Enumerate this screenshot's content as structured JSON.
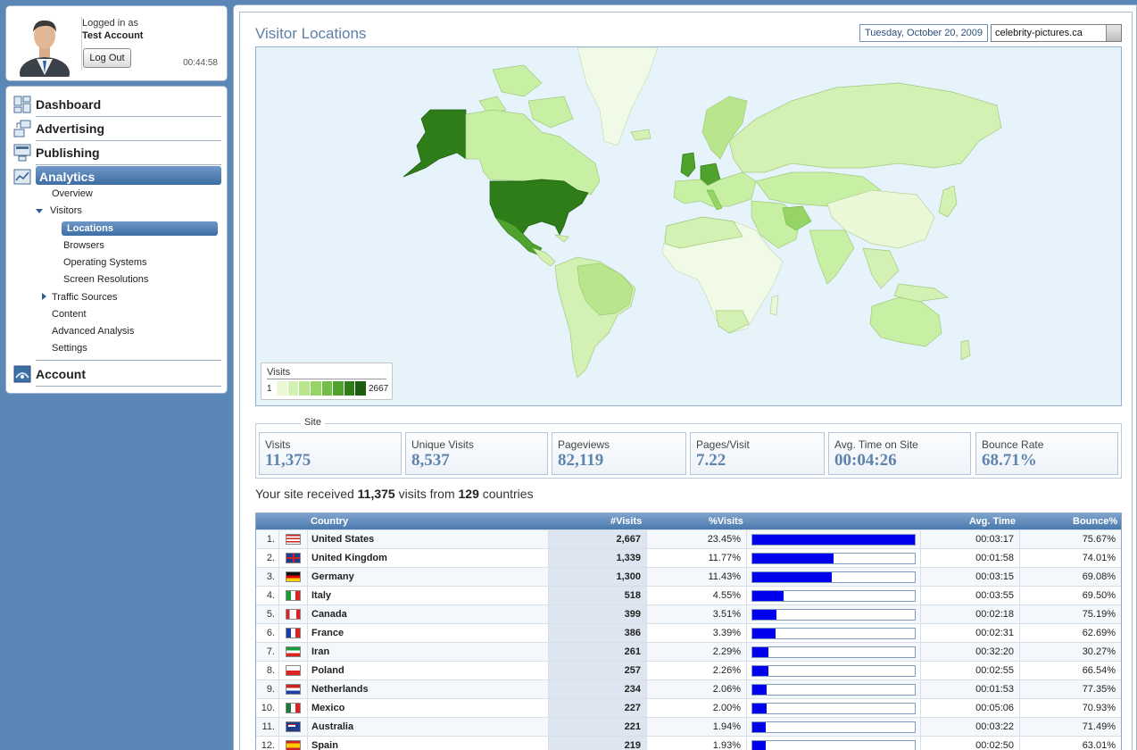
{
  "user": {
    "logged_in_label": "Logged in as",
    "account_name": "Test Account",
    "logout_label": "Log Out",
    "session_time": "00:44:58"
  },
  "nav": {
    "dashboard": "Dashboard",
    "advertising": "Advertising",
    "publishing": "Publishing",
    "analytics": "Analytics",
    "overview": "Overview",
    "visitors": "Visitors",
    "locations": "Locations",
    "browsers": "Browsers",
    "operating_systems": "Operating Systems",
    "screen_resolutions": "Screen Resolutions",
    "traffic_sources": "Traffic Sources",
    "content": "Content",
    "advanced_analysis": "Advanced Analysis",
    "settings": "Settings",
    "account": "Account"
  },
  "page": {
    "title": "Visitor Locations",
    "date": "Tuesday, October 20, 2009",
    "site": "celebrity-pictures.ca"
  },
  "map_legend": {
    "title": "Visits",
    "min": "1",
    "max": "2667",
    "scale_colors": [
      "#eaf8d8",
      "#d4f1b4",
      "#b9e68d",
      "#97d467",
      "#72bf45",
      "#4fa22c",
      "#2e7d19",
      "#1e5c10"
    ]
  },
  "site_metrics": {
    "legend": "Site",
    "items": [
      {
        "label": "Visits",
        "value": "11,375"
      },
      {
        "label": "Unique Visits",
        "value": "8,537"
      },
      {
        "label": "Pageviews",
        "value": "82,119"
      },
      {
        "label": "Pages/Visit",
        "value": "7.22"
      },
      {
        "label": "Avg. Time on Site",
        "value": "00:04:26"
      },
      {
        "label": "Bounce Rate",
        "value": "68.71%"
      }
    ]
  },
  "summary": {
    "prefix": "Your site received ",
    "visits": "11,375",
    "middle": " visits from ",
    "countries": "129",
    "suffix": " countries"
  },
  "table": {
    "headers": {
      "country": "Country",
      "visits": "#Visits",
      "pct": "%Visits",
      "avg_time": "Avg. Time",
      "bounce": "Bounce%"
    },
    "rows": [
      {
        "rank": "1.",
        "country": "United States",
        "visits": "2,667",
        "pct": "23.45%",
        "share": 1.0,
        "time": "00:03:17",
        "bounce": "75.67%",
        "flag": "us"
      },
      {
        "rank": "2.",
        "country": "United Kingdom",
        "visits": "1,339",
        "pct": "11.77%",
        "share": 0.502,
        "time": "00:01:58",
        "bounce": "74.01%",
        "flag": "gb"
      },
      {
        "rank": "3.",
        "country": "Germany",
        "visits": "1,300",
        "pct": "11.43%",
        "share": 0.487,
        "time": "00:03:15",
        "bounce": "69.08%",
        "flag": "de"
      },
      {
        "rank": "4.",
        "country": "Italy",
        "visits": "518",
        "pct": "4.55%",
        "share": 0.194,
        "time": "00:03:55",
        "bounce": "69.50%",
        "flag": "it"
      },
      {
        "rank": "5.",
        "country": "Canada",
        "visits": "399",
        "pct": "3.51%",
        "share": 0.15,
        "time": "00:02:18",
        "bounce": "75.19%",
        "flag": "ca"
      },
      {
        "rank": "6.",
        "country": "France",
        "visits": "386",
        "pct": "3.39%",
        "share": 0.145,
        "time": "00:02:31",
        "bounce": "62.69%",
        "flag": "fr"
      },
      {
        "rank": "7.",
        "country": "Iran",
        "visits": "261",
        "pct": "2.29%",
        "share": 0.098,
        "time": "00:32:20",
        "bounce": "30.27%",
        "flag": "ir"
      },
      {
        "rank": "8.",
        "country": "Poland",
        "visits": "257",
        "pct": "2.26%",
        "share": 0.096,
        "time": "00:02:55",
        "bounce": "66.54%",
        "flag": "pl"
      },
      {
        "rank": "9.",
        "country": "Netherlands",
        "visits": "234",
        "pct": "2.06%",
        "share": 0.088,
        "time": "00:01:53",
        "bounce": "77.35%",
        "flag": "nl"
      },
      {
        "rank": "10.",
        "country": "Mexico",
        "visits": "227",
        "pct": "2.00%",
        "share": 0.085,
        "time": "00:05:06",
        "bounce": "70.93%",
        "flag": "mx"
      },
      {
        "rank": "11.",
        "country": "Australia",
        "visits": "221",
        "pct": "1.94%",
        "share": 0.083,
        "time": "00:03:22",
        "bounce": "71.49%",
        "flag": "au"
      },
      {
        "rank": "12.",
        "country": "Spain",
        "visits": "219",
        "pct": "1.93%",
        "share": 0.082,
        "time": "00:02:50",
        "bounce": "63.01%",
        "flag": "es"
      }
    ]
  }
}
